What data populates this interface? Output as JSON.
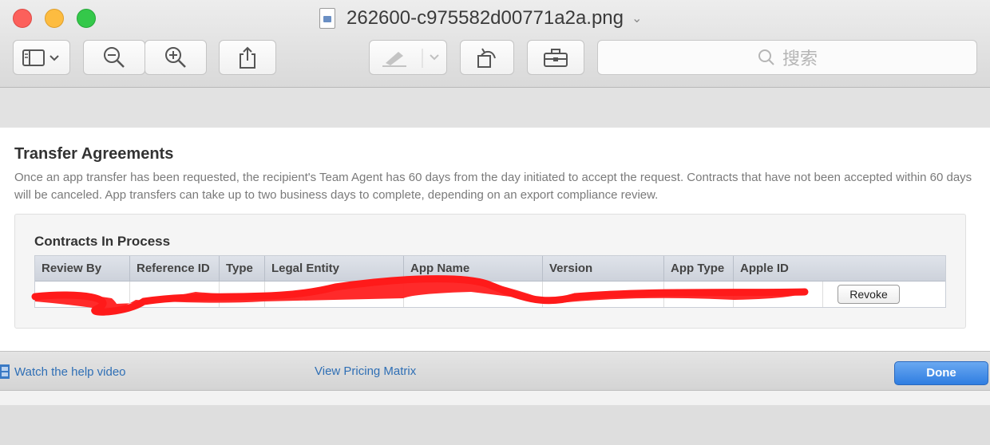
{
  "window": {
    "title": "262600-c975582d00771a2a.png"
  },
  "toolbar": {
    "search_placeholder": "搜索",
    "buttons": [
      {
        "icon": "sidebar-icon"
      },
      {
        "icon": "zoom-out-icon"
      },
      {
        "icon": "zoom-in-icon"
      },
      {
        "icon": "share-icon"
      },
      {
        "icon": "markup-icon"
      },
      {
        "icon": "rotate-icon"
      },
      {
        "icon": "toolbox-icon"
      }
    ]
  },
  "sheet": {
    "title": "Transfer Agreements",
    "description": "Once an app transfer has been requested, the recipient's Team Agent has 60 days from the day initiated to accept the request. Contracts that have not been accepted within 60 days will be canceled. App transfers can take up to two business days to complete, depending on an export compliance review.",
    "panel": {
      "title": "Contracts In Process",
      "columns": [
        "Review By",
        "Reference ID",
        "Type",
        "Legal Entity",
        "App Name",
        "Version",
        "App Type",
        "Apple ID"
      ],
      "row": {
        "action_label": "Revoke"
      }
    }
  },
  "footer": {
    "help_link": "Watch the help video",
    "pricing_link": "View Pricing Matrix",
    "done_label": "Done"
  },
  "colors": {
    "link": "#2f6fb5",
    "done_button": "#2f7de1",
    "redaction": "#ff1a1a"
  }
}
